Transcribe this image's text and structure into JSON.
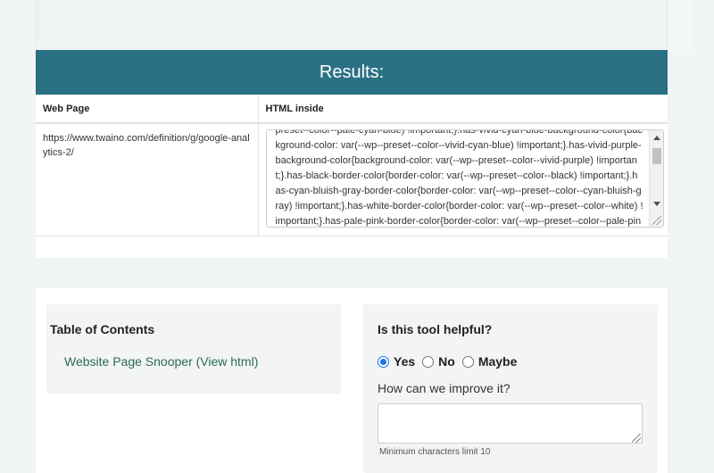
{
  "results": {
    "title": "Results:",
    "columns": [
      "Web Page",
      "HTML inside"
    ],
    "rows": [
      {
        "url": "https://www.twaino.com/definition/g/google-analytics-2/",
        "html_text": "preset--color--pale-cyan-blue) !important;}.has-vivid-cyan-blue-background-color{background-color: var(--wp--preset--color--vivid-cyan-blue) !important;}.has-vivid-purple-background-color{background-color: var(--wp--preset--color--vivid-purple) !important;}.has-black-border-color{border-color: var(--wp--preset--color--black) !important;}.has-cyan-bluish-gray-border-color{border-color: var(--wp--preset--color--cyan-bluish-gray) !important;}.has-white-border-color{border-color: var(--wp--preset--color--white) !important;}.has-pale-pink-border-color{border-color: var(--wp--preset--color--pale-pink) !important;}"
      }
    ]
  },
  "toc": {
    "title": "Table of Contents",
    "link_label": "Website Page Snooper (View html)"
  },
  "feedback": {
    "title": "Is this tool helpful?",
    "options": [
      "Yes",
      "No",
      "Maybe"
    ],
    "selected": "Yes",
    "improve_label": "How can we improve it?",
    "improve_value": "",
    "limit_note": "Minimum characters limit 10"
  },
  "colors": {
    "header_bg": "#2b7184",
    "link": "#2c6b52",
    "radio_accent": "#1a73e8"
  }
}
